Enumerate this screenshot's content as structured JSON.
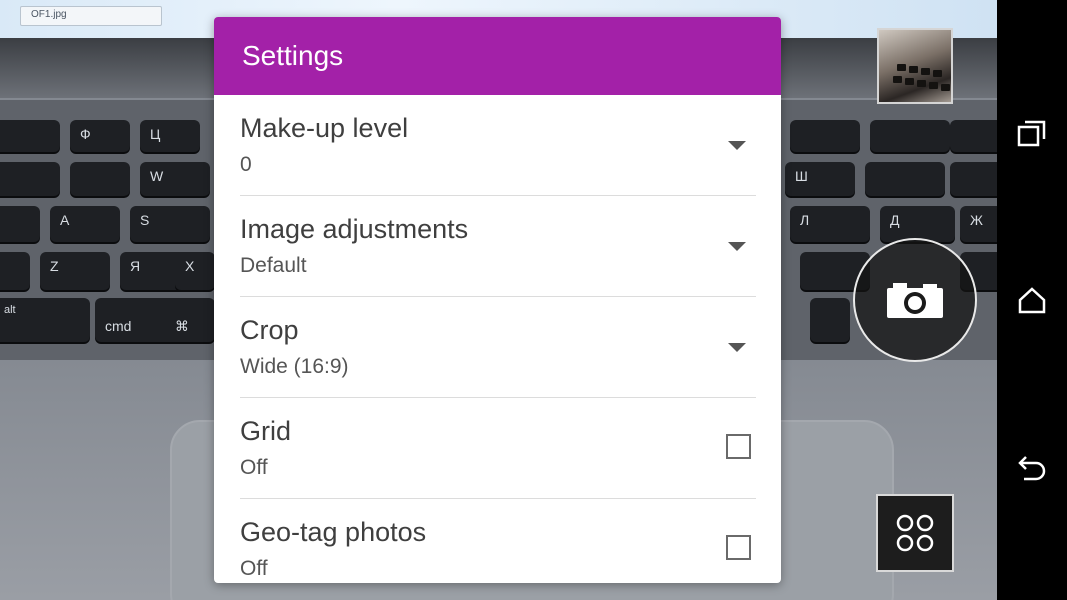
{
  "viewfinder": {
    "file_tab": "OF1.jpg",
    "keys": [
      "Ф",
      "Ц",
      "W",
      "A",
      "S",
      "Я",
      "Z",
      "X",
      "alt",
      "cmd",
      "⌘",
      "Ж",
      "Д",
      "Л",
      "Ш"
    ]
  },
  "dialog": {
    "title": "Settings",
    "items": [
      {
        "title": "Make-up level",
        "value": "0",
        "control": "dropdown"
      },
      {
        "title": "Image adjustments",
        "value": "Default",
        "control": "dropdown"
      },
      {
        "title": "Crop",
        "value": "Wide (16:9)",
        "control": "dropdown"
      },
      {
        "title": "Grid",
        "value": "Off",
        "control": "checkbox"
      },
      {
        "title": "Geo-tag photos",
        "value": "Off",
        "control": "checkbox"
      }
    ]
  },
  "controls": {
    "thumbnail_icon": "last-photo-thumbnail",
    "shutter_icon": "camera-icon",
    "modes_icon": "four-circles-icon"
  },
  "navbar": {
    "recent_icon": "recent-apps-icon",
    "home_icon": "home-icon",
    "back_icon": "back-icon"
  },
  "colors": {
    "header": "#a321a8",
    "dialog_bg": "#ffffff",
    "navbar_bg": "#000000"
  }
}
